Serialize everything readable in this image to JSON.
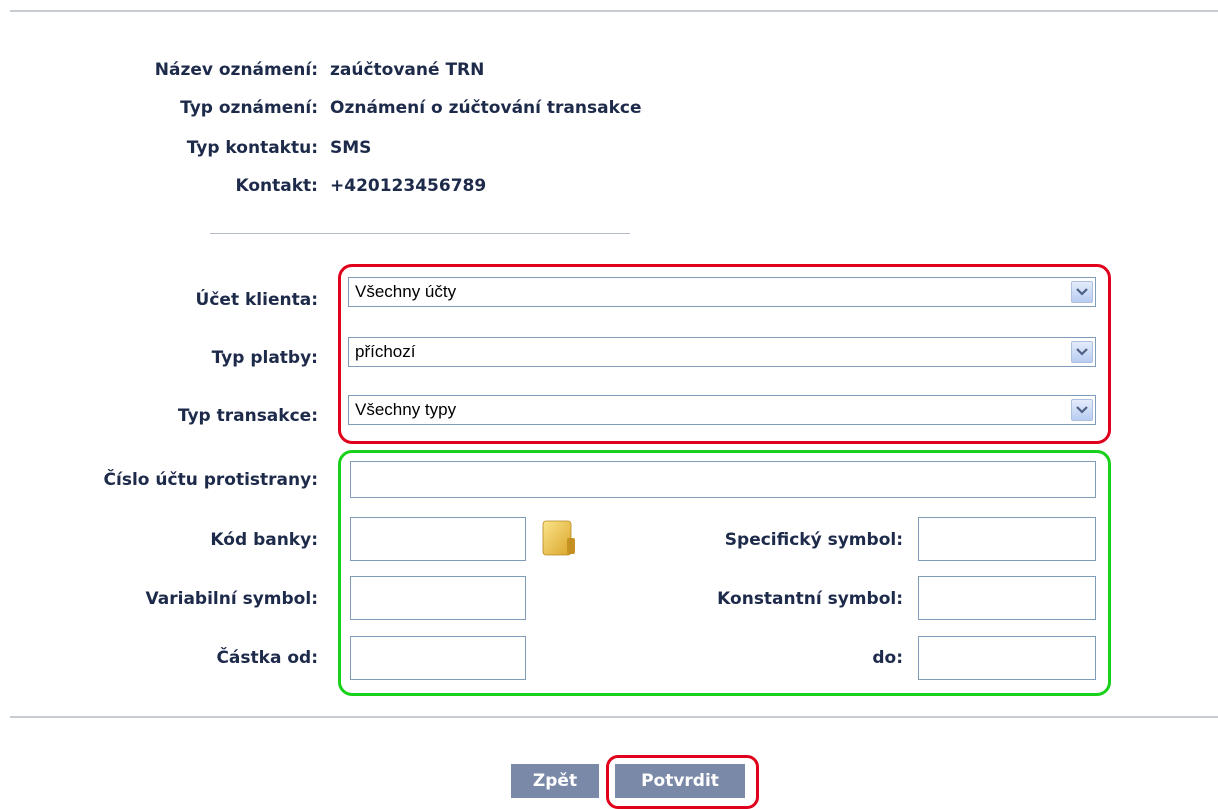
{
  "summary": {
    "rows": [
      {
        "label": "Název oznámení:",
        "value": "zaúčtované TRN"
      },
      {
        "label": "Typ oznámení:",
        "value": "Oznámení o zúčtování transakce"
      },
      {
        "label": "Typ kontaktu:",
        "value": "SMS"
      },
      {
        "label": "Kontakt:",
        "value": "+420123456789"
      }
    ]
  },
  "filters": {
    "account": {
      "label": "Účet klienta:",
      "value": "Všechny účty"
    },
    "payment_type": {
      "label": "Typ platby:",
      "value": "příchozí"
    },
    "transaction_type": {
      "label": "Typ transakce:",
      "value": "Všechny typy"
    }
  },
  "details": {
    "counterparty_account": {
      "label": "Číslo účtu protistrany:",
      "value": ""
    },
    "bank_code": {
      "label": "Kód banky:",
      "value": ""
    },
    "specific_symbol": {
      "label": "Specifický symbol:",
      "value": ""
    },
    "variable_symbol": {
      "label": "Variabilní symbol:",
      "value": ""
    },
    "constant_symbol": {
      "label": "Konstantní symbol:",
      "value": ""
    },
    "amount_from": {
      "label": "Částka od:",
      "value": ""
    },
    "amount_to": {
      "label": "do:",
      "value": ""
    }
  },
  "buttons": {
    "back": "Zpět",
    "confirm": "Potvrdit"
  },
  "colors": {
    "highlight_red": "#e0001b",
    "highlight_green": "#19d11b",
    "button": "#7a89a8"
  },
  "icons": {
    "bank_lookup": "folder-icon",
    "dropdown": "chevron-down-icon"
  }
}
